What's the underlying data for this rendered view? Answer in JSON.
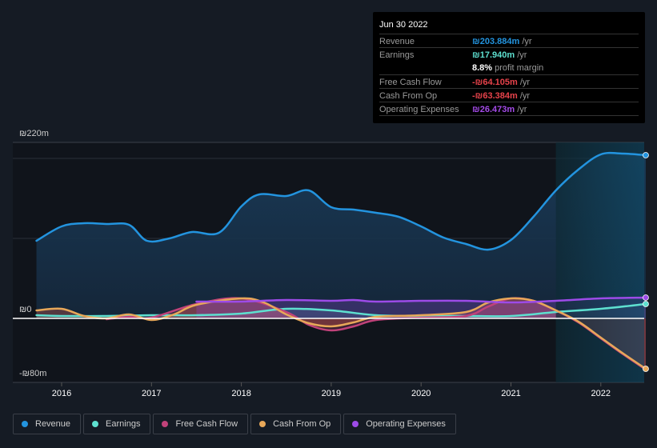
{
  "tooltip": {
    "date": "Jun 30 2022",
    "rows": [
      {
        "label": "Revenue",
        "value": "₪203.884m",
        "unit": " /yr",
        "color": "#2394df"
      },
      {
        "label": "Earnings",
        "value": "₪17.940m",
        "unit": " /yr",
        "color": "#5ee0d0"
      },
      {
        "label": "",
        "value": "8.8%",
        "unit": " profit margin",
        "color": "#ffffff"
      },
      {
        "label": "Free Cash Flow",
        "value": "-₪64.105m",
        "unit": " /yr",
        "color": "#e8434b"
      },
      {
        "label": "Cash From Op",
        "value": "-₪63.384m",
        "unit": " /yr",
        "color": "#e8434b"
      },
      {
        "label": "Operating Expenses",
        "value": "₪26.473m",
        "unit": " /yr",
        "color": "#a44be8"
      }
    ]
  },
  "legend": [
    {
      "label": "Revenue",
      "color": "#2394df"
    },
    {
      "label": "Earnings",
      "color": "#5ee0d0"
    },
    {
      "label": "Free Cash Flow",
      "color": "#c1427a"
    },
    {
      "label": "Cash From Op",
      "color": "#e8a859"
    },
    {
      "label": "Operating Expenses",
      "color": "#9d4be8"
    }
  ],
  "chart_data": {
    "type": "area",
    "title": "",
    "xlabel": "",
    "ylabel": "",
    "ylim": [
      -80,
      220
    ],
    "xlim": [
      2015.7,
      2022.5
    ],
    "y_ticks": [
      {
        "value": 220,
        "label": "₪220m"
      },
      {
        "value": 0,
        "label": "₪0"
      },
      {
        "value": -80,
        "label": "-₪80m"
      }
    ],
    "x_ticks": [
      2016,
      2017,
      2018,
      2019,
      2020,
      2021,
      2022
    ],
    "x_tick_labels": [
      "2016",
      "2017",
      "2018",
      "2019",
      "2020",
      "2021",
      "2022"
    ],
    "gridlines_at": [
      200,
      100
    ],
    "highlight_from": 2021.5,
    "series": [
      {
        "name": "Revenue",
        "color": "#2394df",
        "x": [
          2015.72,
          2016.0,
          2016.25,
          2016.5,
          2016.75,
          2016.95,
          2017.2,
          2017.45,
          2017.75,
          2018.0,
          2018.2,
          2018.5,
          2018.75,
          2019.0,
          2019.25,
          2019.5,
          2019.75,
          2020.0,
          2020.25,
          2020.5,
          2020.75,
          2021.0,
          2021.25,
          2021.5,
          2021.75,
          2022.0,
          2022.25,
          2022.5
        ],
        "y": [
          97,
          115,
          119,
          118,
          117,
          97,
          100,
          108,
          107,
          140,
          155,
          153,
          160,
          139,
          136,
          132,
          127,
          115,
          101,
          93,
          86,
          98,
          127,
          160,
          186,
          205,
          206,
          204
        ]
      },
      {
        "name": "Earnings",
        "color": "#5ee0d0",
        "x": [
          2015.72,
          2016.0,
          2016.5,
          2017.0,
          2017.5,
          2018.0,
          2018.5,
          2019.0,
          2019.5,
          2020.0,
          2020.5,
          2021.0,
          2021.5,
          2022.0,
          2022.5
        ],
        "y": [
          4,
          3,
          3,
          4,
          4,
          6,
          12,
          10,
          4,
          3,
          3,
          3,
          8,
          12,
          18
        ]
      },
      {
        "name": "Free Cash Flow",
        "color": "#c1427a",
        "x": [
          2016.5,
          2016.75,
          2017.0,
          2017.5,
          2018.0,
          2018.5,
          2018.75,
          2019.0,
          2019.25,
          2019.5,
          2020.0,
          2020.5,
          2020.75,
          2021.0,
          2021.25,
          2021.5,
          2021.75,
          2022.0,
          2022.25,
          2022.5
        ],
        "y": [
          -1,
          2,
          1,
          18,
          25,
          8,
          -8,
          -15,
          -10,
          -2,
          1,
          3,
          15,
          25,
          22,
          10,
          -5,
          -25,
          -45,
          -64
        ]
      },
      {
        "name": "Cash From Op",
        "color": "#e8a859",
        "x": [
          2015.72,
          2016.0,
          2016.25,
          2016.5,
          2016.75,
          2017.0,
          2017.25,
          2017.5,
          2018.0,
          2018.25,
          2018.5,
          2018.75,
          2019.0,
          2019.25,
          2019.5,
          2020.0,
          2020.5,
          2020.75,
          2021.0,
          2021.25,
          2021.5,
          2021.75,
          2022.0,
          2022.25,
          2022.5
        ],
        "y": [
          10,
          12,
          3,
          0,
          5,
          -2,
          5,
          17,
          25,
          20,
          5,
          -6,
          -10,
          -5,
          2,
          4,
          8,
          20,
          25,
          22,
          10,
          -4,
          -24,
          -44,
          -63
        ]
      },
      {
        "name": "Operating Expenses",
        "color": "#9d4be8",
        "x": [
          2017.5,
          2018.0,
          2018.5,
          2019.0,
          2019.25,
          2019.5,
          2020.0,
          2020.5,
          2021.0,
          2021.5,
          2022.0,
          2022.5
        ],
        "y": [
          21,
          21,
          23,
          22,
          23,
          21,
          22,
          22,
          20,
          22,
          25,
          26
        ]
      }
    ]
  }
}
